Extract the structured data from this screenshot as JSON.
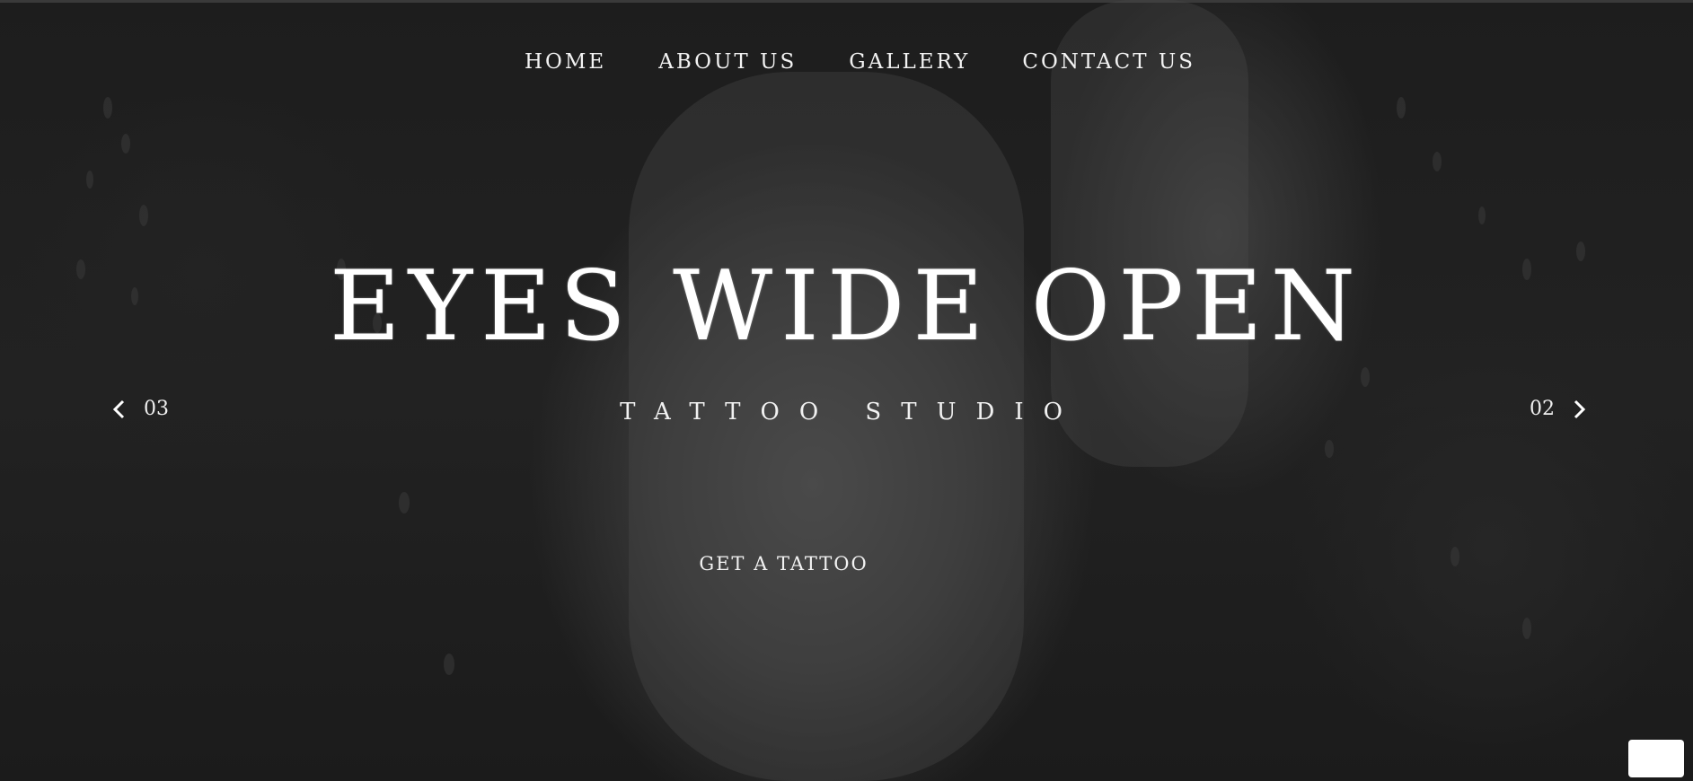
{
  "nav": {
    "items": [
      {
        "label": "HOME"
      },
      {
        "label": "ABOUT US"
      },
      {
        "label": "GALLERY"
      },
      {
        "label": "CONTACT US"
      }
    ]
  },
  "hero": {
    "title": "EYES WIDE OPEN",
    "subtitle": "TATTOO STUDIO",
    "cta_label": "GET A TATTOO"
  },
  "slider": {
    "prev_number": "03",
    "next_number": "02",
    "prev_icon": "chevron-left-icon",
    "next_icon": "chevron-right-icon"
  },
  "colors": {
    "background": "#1d1d1d",
    "text": "#ffffff"
  }
}
